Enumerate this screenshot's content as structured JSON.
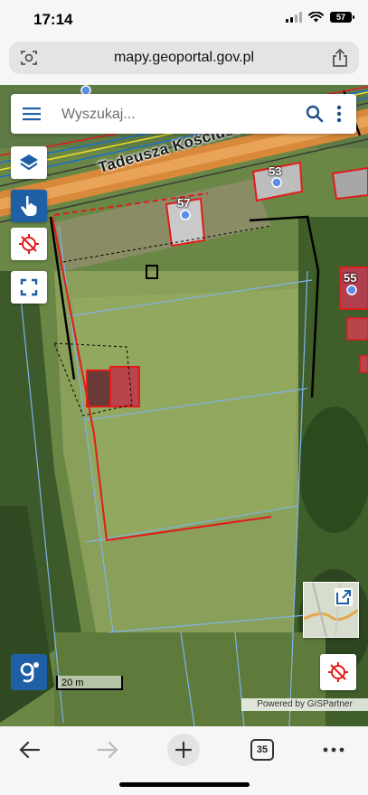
{
  "status": {
    "time": "17:14",
    "battery": "57"
  },
  "browser": {
    "url": "mapy.geoportal.gov.pl",
    "tabs_count": "35"
  },
  "search": {
    "placeholder": "Wyszukaj..."
  },
  "map": {
    "street_name": "Tadeusza Kościuszki",
    "house_numbers": [
      "53",
      "57",
      "55"
    ],
    "scale_label": "20 m",
    "attribution": "Powered by GISPartner"
  },
  "colors": {
    "accent": "#1f5fa6",
    "parcel_red": "#e21b1b",
    "parcel_blue": "#7fb3e8"
  }
}
